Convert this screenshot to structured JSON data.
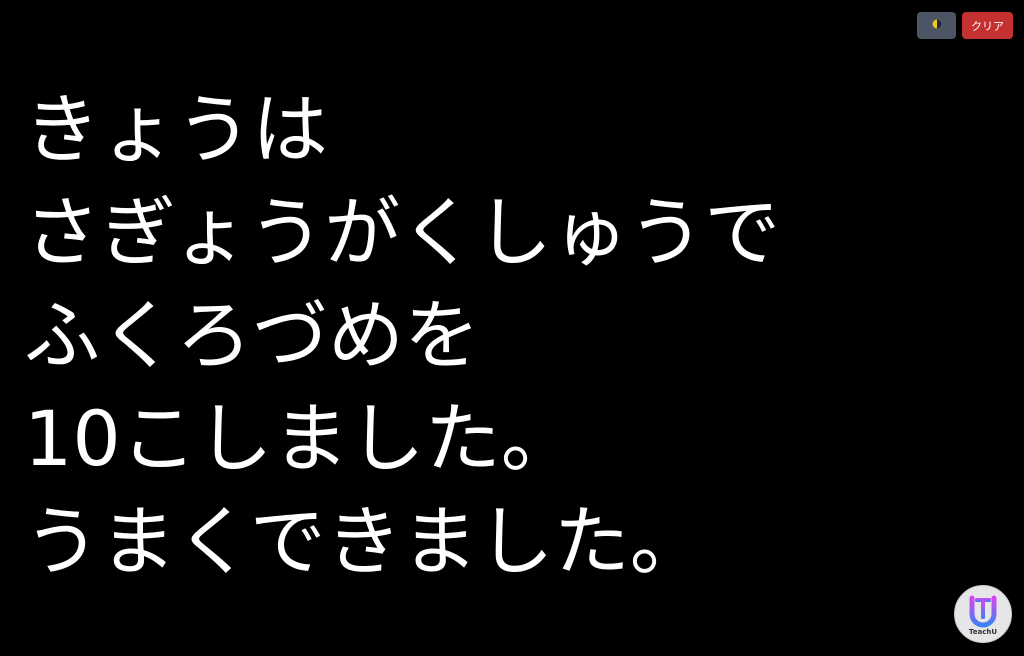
{
  "toolbar": {
    "theme_icon": "half-moon-icon",
    "clear_label": "クリア"
  },
  "main": {
    "lines": [
      "きょうは",
      "さぎょうがくしゅうで",
      "ふくろづめを",
      "10こしました。",
      "うまくできました。"
    ]
  },
  "logo": {
    "text": "TeachU"
  },
  "colors": {
    "background": "#000000",
    "text": "#ffffff",
    "theme_button": "#4b5563",
    "clear_button": "#c53030",
    "logo_gradient_top": "#d946ef",
    "logo_gradient_bottom": "#3b82f6"
  }
}
